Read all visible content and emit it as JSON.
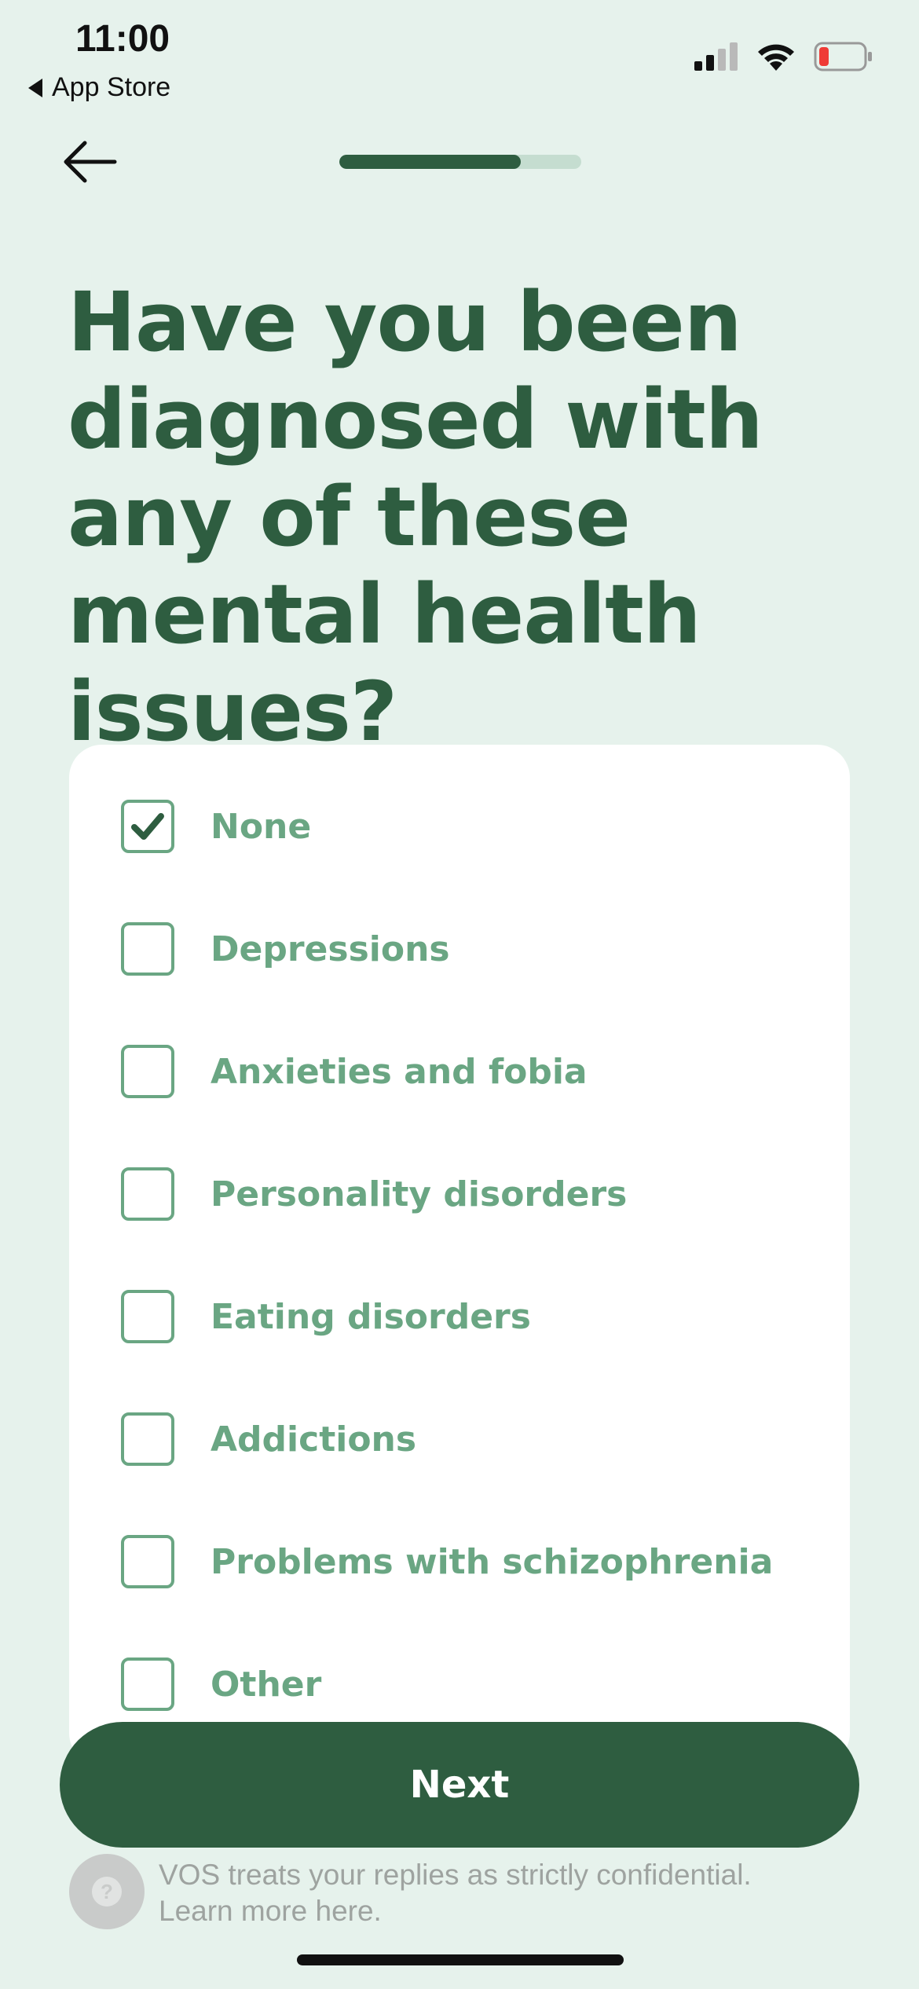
{
  "status_bar": {
    "time": "11:00",
    "back_app": "App Store",
    "icons": [
      "cellular-signal-icon",
      "wifi-icon",
      "battery-low-icon"
    ]
  },
  "nav": {
    "back_icon": "arrow-left-icon",
    "progress": 0.75
  },
  "question": "Have you been diagnosed with any of these mental health issues?",
  "options": [
    {
      "label": "None",
      "checked": true
    },
    {
      "label": "Depressions",
      "checked": false
    },
    {
      "label": "Anxieties and fobia",
      "checked": false
    },
    {
      "label": "Personality disorders",
      "checked": false
    },
    {
      "label": "Eating disorders",
      "checked": false
    },
    {
      "label": "Addictions",
      "checked": false
    },
    {
      "label": "Problems with schizophrenia",
      "checked": false
    },
    {
      "label": "Other",
      "checked": false
    }
  ],
  "next_button": "Next",
  "footer": {
    "help_icon": "question-icon",
    "line1": "VOS treats your replies as strictly confidential.",
    "line2": "Learn more here."
  },
  "colors": {
    "background": "#e6f2ec",
    "primary": "#2e5d40",
    "option_text": "#6aa683",
    "track": "#c5ddd0"
  }
}
